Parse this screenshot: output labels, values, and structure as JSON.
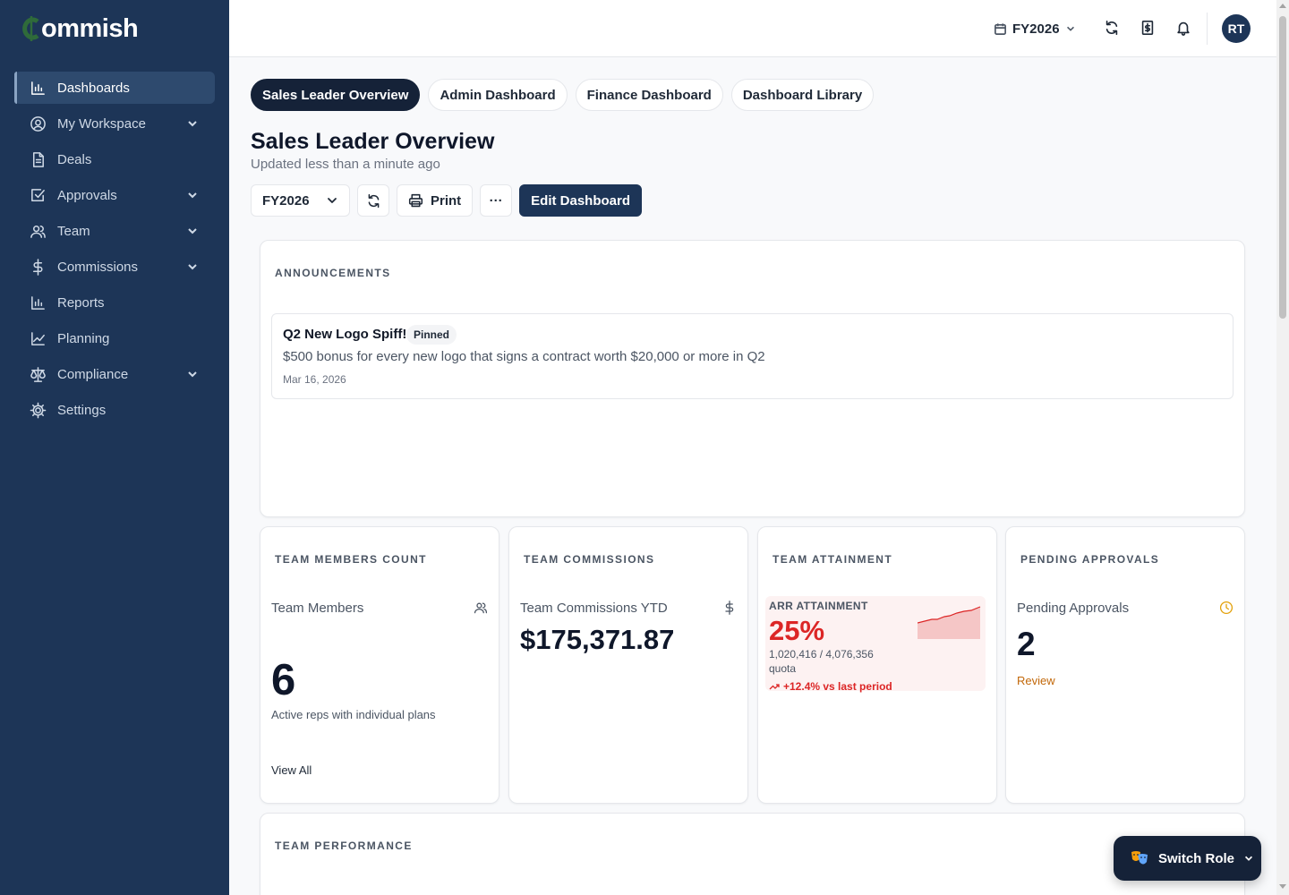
{
  "brand": {
    "name_rest": "ommish",
    "accent": "#2f6b3a"
  },
  "sidebar": {
    "items": [
      {
        "label": "Dashboards",
        "icon": "bar-chart-icon",
        "active": true,
        "has_children": false
      },
      {
        "label": "My Workspace",
        "icon": "user-circle-icon",
        "has_children": true
      },
      {
        "label": "Deals",
        "icon": "file-icon",
        "has_children": false
      },
      {
        "label": "Approvals",
        "icon": "check-square-icon",
        "has_children": true
      },
      {
        "label": "Team",
        "icon": "users-icon",
        "has_children": true
      },
      {
        "label": "Commissions",
        "icon": "dollar-icon",
        "has_children": true
      },
      {
        "label": "Reports",
        "icon": "bar-chart-icon",
        "has_children": false
      },
      {
        "label": "Planning",
        "icon": "line-chart-icon",
        "has_children": false
      },
      {
        "label": "Compliance",
        "icon": "scale-icon",
        "has_children": true
      },
      {
        "label": "Settings",
        "icon": "gear-icon",
        "has_children": false
      }
    ]
  },
  "header": {
    "fiscal_year": "FY2026",
    "avatar_initials": "RT"
  },
  "tabs": [
    {
      "label": "Sales Leader Overview",
      "active": true
    },
    {
      "label": "Admin Dashboard",
      "active": false
    },
    {
      "label": "Finance Dashboard",
      "active": false
    },
    {
      "label": "Dashboard Library",
      "active": false
    }
  ],
  "page": {
    "title": "Sales Leader Overview",
    "subtitle": "Updated less than a minute ago"
  },
  "toolbar": {
    "fy_value": "FY2026",
    "print_label": "Print",
    "more_label": "···",
    "edit_label": "Edit Dashboard"
  },
  "announcements": {
    "heading": "ANNOUNCEMENTS",
    "items": [
      {
        "title": "Q2 New Logo Spiff!",
        "badge": "Pinned",
        "body": "$500 bonus for every new logo that signs a contract worth $20,000 or more in Q2",
        "date": "Mar 16, 2026"
      }
    ]
  },
  "widgets": {
    "team_members": {
      "heading": "TEAM MEMBERS COUNT",
      "label": "Team Members",
      "value": "6",
      "note": "Active reps with individual plans",
      "link": "View All"
    },
    "team_commissions": {
      "heading": "TEAM COMMISSIONS",
      "label": "Team Commissions YTD",
      "value": "$175,371.87"
    },
    "team_attainment": {
      "heading": "TEAM ATTAINMENT",
      "label": "ARR ATTAINMENT",
      "value": "25%",
      "detail": "1,020,416 / 4,076,356",
      "quota_label": "quota",
      "trend": "+12.4% vs last period",
      "trend_color": "#dc2626"
    },
    "pending_approvals": {
      "heading": "PENDING APPROVALS",
      "label": "Pending Approvals",
      "value": "2",
      "link": "Review",
      "link_color": "#c2680a",
      "icon_color": "#e3a008"
    },
    "team_performance": {
      "heading": "TEAM PERFORMANCE"
    }
  },
  "switch_role": {
    "label": "Switch Role",
    "icon": "theater-masks-icon"
  }
}
